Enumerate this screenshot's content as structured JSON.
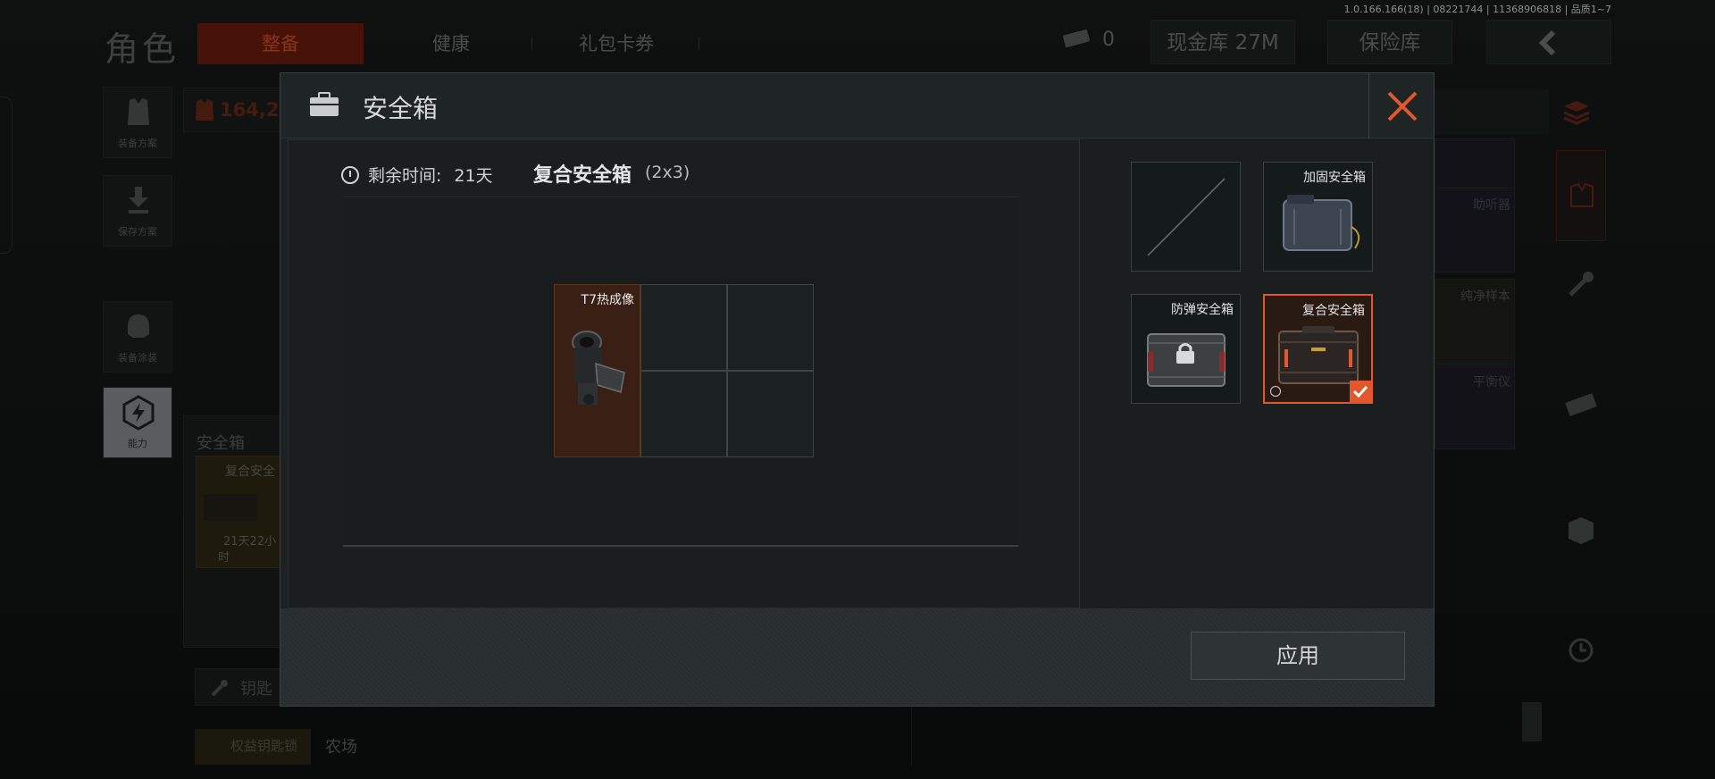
{
  "version_text": "1.0.166.166(18) | 08221744 | 11368906818 | 品质1~7",
  "background": {
    "title": "角色",
    "tabs": [
      "整备",
      "健康",
      "礼包卡券"
    ],
    "currency_count": "0",
    "cash_vault": "现金库 27M",
    "insurance_vault": "保险库",
    "value_partial": "164,2",
    "side_buttons": [
      "装备方案",
      "保存方案",
      "装备涂装",
      "能力"
    ],
    "safebox_section_title": "安全箱",
    "safebox_card_name": "复合安全",
    "safebox_card_time": "21天22小",
    "safebox_card_time2": "时",
    "keychain_label": "钥匙",
    "key_item_label": "权益钥匙锁",
    "farm_label": "农场",
    "inventory_labels": [
      "助听器",
      "纯净样本",
      "平衡仪"
    ]
  },
  "modal": {
    "title": "安全箱",
    "remaining_label": "剩余时间:",
    "remaining_value": "21天",
    "case_name": "复合安全箱",
    "case_size": "(2x3)",
    "stored_item": {
      "name": "T7热成像",
      "width_cells": 1,
      "height_cells": 2
    },
    "grid": {
      "columns": 3,
      "rows": 2
    },
    "options": [
      {
        "name": "",
        "state": "empty"
      },
      {
        "name": "加固安全箱",
        "state": "available"
      },
      {
        "name": "防弹安全箱",
        "state": "locked"
      },
      {
        "name": "复合安全箱",
        "state": "selected"
      }
    ],
    "apply_label": "应用"
  },
  "colors": {
    "accent": "#e0582b",
    "item_bg": "#3a1f15",
    "tab_active_bg": "#6e1d0d"
  }
}
